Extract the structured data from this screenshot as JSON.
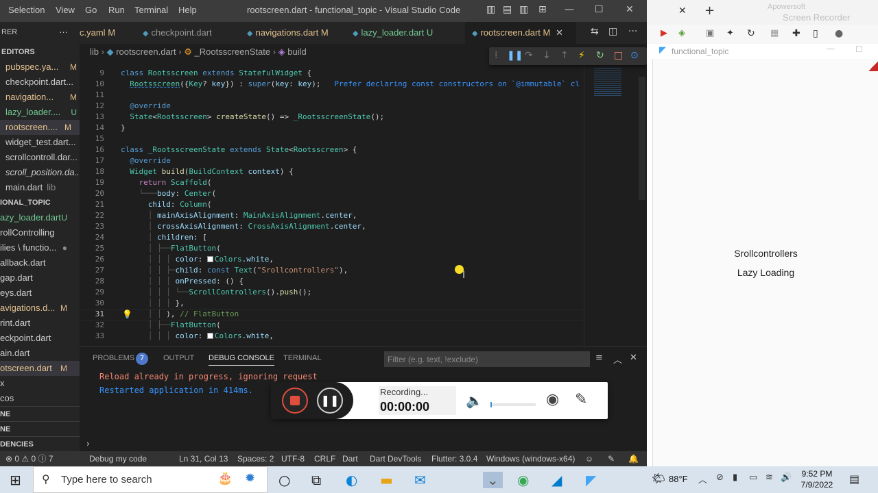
{
  "titlebar": {
    "menu": [
      "Selection",
      "View",
      "Go",
      "Run",
      "Terminal",
      "Help"
    ],
    "title": "rootscreen.dart - functional_topic - Visual Studio Code"
  },
  "tabs": [
    {
      "label": "c.yaml",
      "badge": "M"
    },
    {
      "label": "checkpoint.dart",
      "badge": ""
    },
    {
      "label": "navigations.dart",
      "badge": "M"
    },
    {
      "label": "lazy_loader.dart",
      "badge": "U"
    },
    {
      "label": "rootscreen.dart",
      "badge": "M",
      "active": true
    }
  ],
  "breadcrumb": [
    "lib",
    "rootscreen.dart",
    "_RootsscreenState",
    "build"
  ],
  "sidebar": {
    "editors_header": "EDITORS",
    "open_editors": [
      {
        "label": "pubspec.ya...",
        "badge": "M"
      },
      {
        "label": "checkpoint.dart...",
        "badge": ""
      },
      {
        "label": "navigation...",
        "badge": "M"
      },
      {
        "label": "lazy_loader....",
        "badge": "U"
      },
      {
        "label": "rootscreen....",
        "badge": "M"
      },
      {
        "label": "widget_test.dart...",
        "badge": ""
      },
      {
        "label": "scrollcontroll.dar...",
        "badge": ""
      },
      {
        "label": "scroll_position.da...",
        "badge": ""
      },
      {
        "label": "main.dart",
        "badge": "lib"
      }
    ],
    "project_header": "IONAL_TOPIC",
    "files": [
      {
        "label": "azy_loader.dart",
        "badge": "U"
      },
      {
        "label": "rollControlling",
        "badge": ""
      },
      {
        "label": "ilies \\ functio...",
        "badge": "●"
      },
      {
        "label": "allback.dart",
        "badge": ""
      },
      {
        "label": "gap.dart",
        "badge": ""
      },
      {
        "label": "eys.dart",
        "badge": ""
      },
      {
        "label": "avigations.d...",
        "badge": "M"
      },
      {
        "label": "rint.dart",
        "badge": ""
      },
      {
        "label": "eckpoint.dart",
        "badge": ""
      },
      {
        "label": "ain.dart",
        "badge": ""
      },
      {
        "label": "otscreen.dart",
        "badge": "M"
      },
      {
        "label": "x",
        "badge": ""
      },
      {
        "label": "cos",
        "badge": ""
      }
    ],
    "bottom_sections": [
      "NE",
      "NE",
      "DENCIES"
    ]
  },
  "editor": {
    "line_numbers": [
      "9",
      "10",
      "11",
      "12",
      "13",
      "14",
      "15",
      "16",
      "17",
      "18",
      "19",
      "20",
      "21",
      "22",
      "23",
      "24",
      "25",
      "26",
      "27",
      "28",
      "29",
      "30",
      "31",
      "32",
      "33"
    ],
    "hint": "Prefer declaring const constructors on `@immutable` cl",
    "flatbutton_comment": "// FlatButton"
  },
  "panel": {
    "tabs": [
      "PROBLEMS",
      "OUTPUT",
      "DEBUG CONSOLE",
      "TERMINAL"
    ],
    "problems_count": "7",
    "filter_placeholder": "Filter (e.g. text, !exclude)",
    "console": [
      {
        "text": "Reload already in progress, ignoring request",
        "color": "#f48771"
      },
      {
        "text": "Restarted application in 414ms.",
        "color": "#3794ff"
      }
    ]
  },
  "statusbar": {
    "errors": "⊗ 0 ⚠ 0 ⓘ 7",
    "debug": "Debug my code",
    "position": "Ln 31, Col 13",
    "spaces": "Spaces: 2",
    "encoding": "UTF-8",
    "eol": "CRLF",
    "language": "Dart",
    "devtools": "Dart DevTools",
    "flutter": "Flutter: 3.0.4",
    "device": "Windows (windows-x64)"
  },
  "recorder": {
    "status": "Recording...",
    "time": "00:00:00",
    "brand_line1": "Apowersoft",
    "brand_line2": "Screen Recorder"
  },
  "app": {
    "title": "functional_topic",
    "buttons": [
      "Srollcontrollers",
      "Lazy Loading"
    ]
  },
  "taskbar": {
    "search_placeholder": "Type here to search",
    "weather": "88°F",
    "time": "9:52 PM",
    "date": "7/9/2022"
  },
  "colors": {
    "vscode_bg": "#1e1e1e",
    "sidebar_bg": "#252526",
    "statusbar_bg": "#333333",
    "accent": "#3794ff"
  }
}
